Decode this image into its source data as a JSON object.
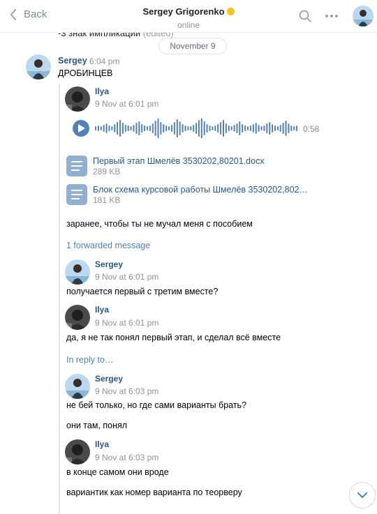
{
  "header": {
    "back_label": "Back",
    "contact_name": "Sergey Grigorenko",
    "status": "online"
  },
  "previous_message": {
    "text": "-3 знак импликации",
    "edited": "(edited)"
  },
  "date_separator": "November 9",
  "message": {
    "author": "Sergey",
    "time": "6:04 pm",
    "text": "ДРОБИНЦЕВ"
  },
  "forwarded": {
    "first": {
      "author": "Ilya",
      "time": "9 Nov at 6:01 pm",
      "audio_duration": "0:58",
      "documents": [
        {
          "name": "Первый этап Шмелёв 3530202,80201.docx",
          "size": "289 KB"
        },
        {
          "name": "Блок схема курсовой работы Шмелёв 3530202,802…",
          "size": "181 KB"
        }
      ],
      "text": "заранее, чтобы ты не мучал меня с пособием"
    },
    "forwarded_link": "1 forwarded message",
    "second": {
      "author": "Sergey",
      "time": "9 Nov at 6:01 pm",
      "text": "получается первый с третим вместе?"
    },
    "third": {
      "author": "Ilya",
      "time": "9 Nov at 6:01 pm",
      "text": "да, я не так понял первый этап, и сделал всё вместе"
    },
    "reply_link": "In reply to…",
    "fourth": {
      "author": "Sergey",
      "time": "9 Nov at 6:03 pm",
      "text1": "не бей только, но где сами варианты брать?",
      "text2": "они там, понял"
    },
    "fifth": {
      "author": "Ilya",
      "time": "9 Nov at 6:03 pm",
      "text1": "в конце самом они вроде",
      "text2": "вариантик как номер варианта по теорверу"
    }
  },
  "icons": {
    "back": "chevron-left-icon",
    "search": "search-icon",
    "more": "more-horizontal-icon",
    "play": "play-icon",
    "document": "document-icon",
    "scroll": "chevron-down-icon"
  },
  "colors": {
    "link": "#2a5885",
    "accent": "#5181b8",
    "muted": "#939393"
  }
}
